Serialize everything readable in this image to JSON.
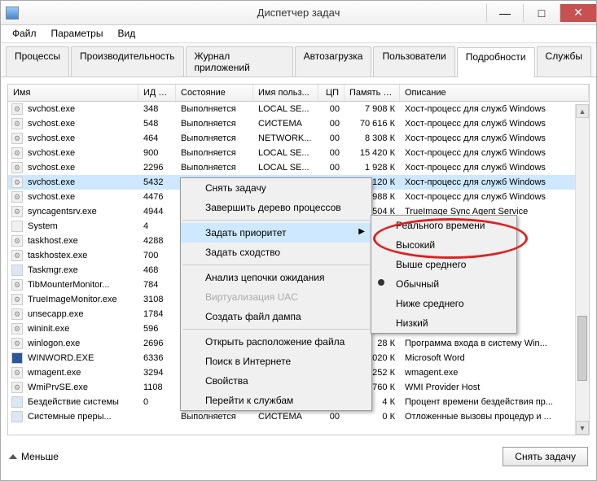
{
  "window": {
    "title": "Диспетчер задач"
  },
  "menu": {
    "file": "Файл",
    "options": "Параметры",
    "view": "Вид"
  },
  "tabs": [
    {
      "label": "Процессы"
    },
    {
      "label": "Производительность"
    },
    {
      "label": "Журнал приложений"
    },
    {
      "label": "Автозагрузка"
    },
    {
      "label": "Пользователи"
    },
    {
      "label": "Подробности",
      "active": true
    },
    {
      "label": "Службы"
    }
  ],
  "columns": {
    "name": "Имя",
    "pid": "ИД п...",
    "state": "Состояние",
    "user": "Имя польз...",
    "cpu": "ЦП",
    "mem": "Память (ч...",
    "desc": "Описание"
  },
  "rows": [
    {
      "icon": "cog",
      "name": "svchost.exe",
      "pid": "348",
      "state": "Выполняется",
      "user": "LOCAL SE...",
      "cpu": "00",
      "mem": "7 908 К",
      "desc": "Хост-процесс для служб Windows"
    },
    {
      "icon": "cog",
      "name": "svchost.exe",
      "pid": "548",
      "state": "Выполняется",
      "user": "СИСТЕМА",
      "cpu": "00",
      "mem": "70 616 К",
      "desc": "Хост-процесс для служб Windows"
    },
    {
      "icon": "cog",
      "name": "svchost.exe",
      "pid": "464",
      "state": "Выполняется",
      "user": "NETWORK...",
      "cpu": "00",
      "mem": "8 308 К",
      "desc": "Хост-процесс для служб Windows"
    },
    {
      "icon": "cog",
      "name": "svchost.exe",
      "pid": "900",
      "state": "Выполняется",
      "user": "LOCAL SE...",
      "cpu": "00",
      "mem": "15 420 К",
      "desc": "Хост-процесс для служб Windows"
    },
    {
      "icon": "cog",
      "name": "svchost.exe",
      "pid": "2296",
      "state": "Выполняется",
      "user": "LOCAL SE...",
      "cpu": "00",
      "mem": "1 928 К",
      "desc": "Хост-процесс для служб Windows"
    },
    {
      "icon": "cog",
      "name": "svchost.exe",
      "pid": "5432",
      "state": "Выполняется",
      "user": "LOCAL SE...",
      "cpu": "00",
      "mem": "1 120 К",
      "desc": "Хост-процесс для служб Windows",
      "selected": true
    },
    {
      "icon": "cog",
      "name": "svchost.exe",
      "pid": "4476",
      "state": "",
      "user": "",
      "cpu": "",
      "mem": "988 К",
      "desc": "Хост-процесс для служб Windows"
    },
    {
      "icon": "cog",
      "name": "syncagentsrv.exe",
      "pid": "4944",
      "state": "",
      "user": "",
      "cpu": "",
      "mem": "1 504 К",
      "desc": "TrueImage Sync Agent Service"
    },
    {
      "icon": "",
      "name": "System",
      "pid": "4",
      "state": "",
      "user": "",
      "cpu": "",
      "mem": "",
      "desc": ""
    },
    {
      "icon": "cog",
      "name": "taskhost.exe",
      "pid": "4288",
      "state": "",
      "user": "",
      "cpu": "",
      "mem": "",
      "desc": "Windows"
    },
    {
      "icon": "cog",
      "name": "taskhostex.exe",
      "pid": "700",
      "state": "",
      "user": "",
      "cpu": "",
      "mem": "",
      "desc": "Windows"
    },
    {
      "icon": "sys",
      "name": "Taskmgr.exe",
      "pid": "468",
      "state": "",
      "user": "",
      "cpu": "",
      "mem": "",
      "desc": ""
    },
    {
      "icon": "cog",
      "name": "TibMounterMonitor...",
      "pid": "784",
      "state": "",
      "user": "",
      "cpu": "",
      "mem": "",
      "desc": ""
    },
    {
      "icon": "cog",
      "name": "TrueImageMonitor.exe",
      "pid": "3108",
      "state": "",
      "user": "",
      "cpu": "",
      "mem": "",
      "desc": "tor"
    },
    {
      "icon": "cog",
      "name": "unsecapp.exe",
      "pid": "1784",
      "state": "",
      "user": "",
      "cpu": "",
      "mem": "",
      "desc": "ous callb..."
    },
    {
      "icon": "cog",
      "name": "wininit.exe",
      "pid": "596",
      "state": "",
      "user": "",
      "cpu": "",
      "mem": "",
      "desc": "ний Wind..."
    },
    {
      "icon": "cog",
      "name": "winlogon.exe",
      "pid": "2696",
      "state": "",
      "user": "",
      "cpu": "",
      "mem": "28 К",
      "desc": "Программа входа в систему Win..."
    },
    {
      "icon": "doc",
      "name": "WINWORD.EXE",
      "pid": "6336",
      "state": "",
      "user": "",
      "cpu": "",
      "mem": "50 020 К",
      "desc": "Microsoft Word"
    },
    {
      "icon": "cog",
      "name": "wmagent.exe",
      "pid": "3294",
      "state": "",
      "user": "",
      "cpu": "",
      "mem": "252 К",
      "desc": "wmagent.exe"
    },
    {
      "icon": "cog",
      "name": "WmiPrvSE.exe",
      "pid": "1108",
      "state": "",
      "user": "",
      "cpu": "",
      "mem": "8 760 К",
      "desc": "WMI Provider Host"
    },
    {
      "icon": "sys",
      "name": "Бездействие системы",
      "pid": "0",
      "state": "Выполняется",
      "user": "СИСТЕМА",
      "cpu": "99",
      "mem": "4 К",
      "desc": "Процент времени бездействия пр..."
    },
    {
      "icon": "sys",
      "name": "Системные преры...",
      "pid": "",
      "state": "Выполняется",
      "user": "СИСТЕМА",
      "cpu": "00",
      "mem": "0 К",
      "desc": "Отложенные вызовы процедур и ..."
    }
  ],
  "context_menu": {
    "end_task": "Снять задачу",
    "end_tree": "Завершить дерево процессов",
    "set_priority": "Задать приоритет",
    "set_affinity": "Задать сходство",
    "analyze_wait": "Анализ цепочки ожидания",
    "uac": "Виртуализация UAC",
    "create_dump": "Создать файл дампа",
    "open_location": "Открыть расположение файла",
    "search_online": "Поиск в Интернете",
    "properties": "Свойства",
    "goto_services": "Перейти к службам"
  },
  "priority_menu": {
    "realtime": "Реального времени",
    "high": "Высокий",
    "above": "Выше среднего",
    "normal": "Обычный",
    "below": "Ниже среднего",
    "low": "Низкий"
  },
  "footer": {
    "fewer": "Меньше",
    "end_task": "Снять задачу"
  }
}
